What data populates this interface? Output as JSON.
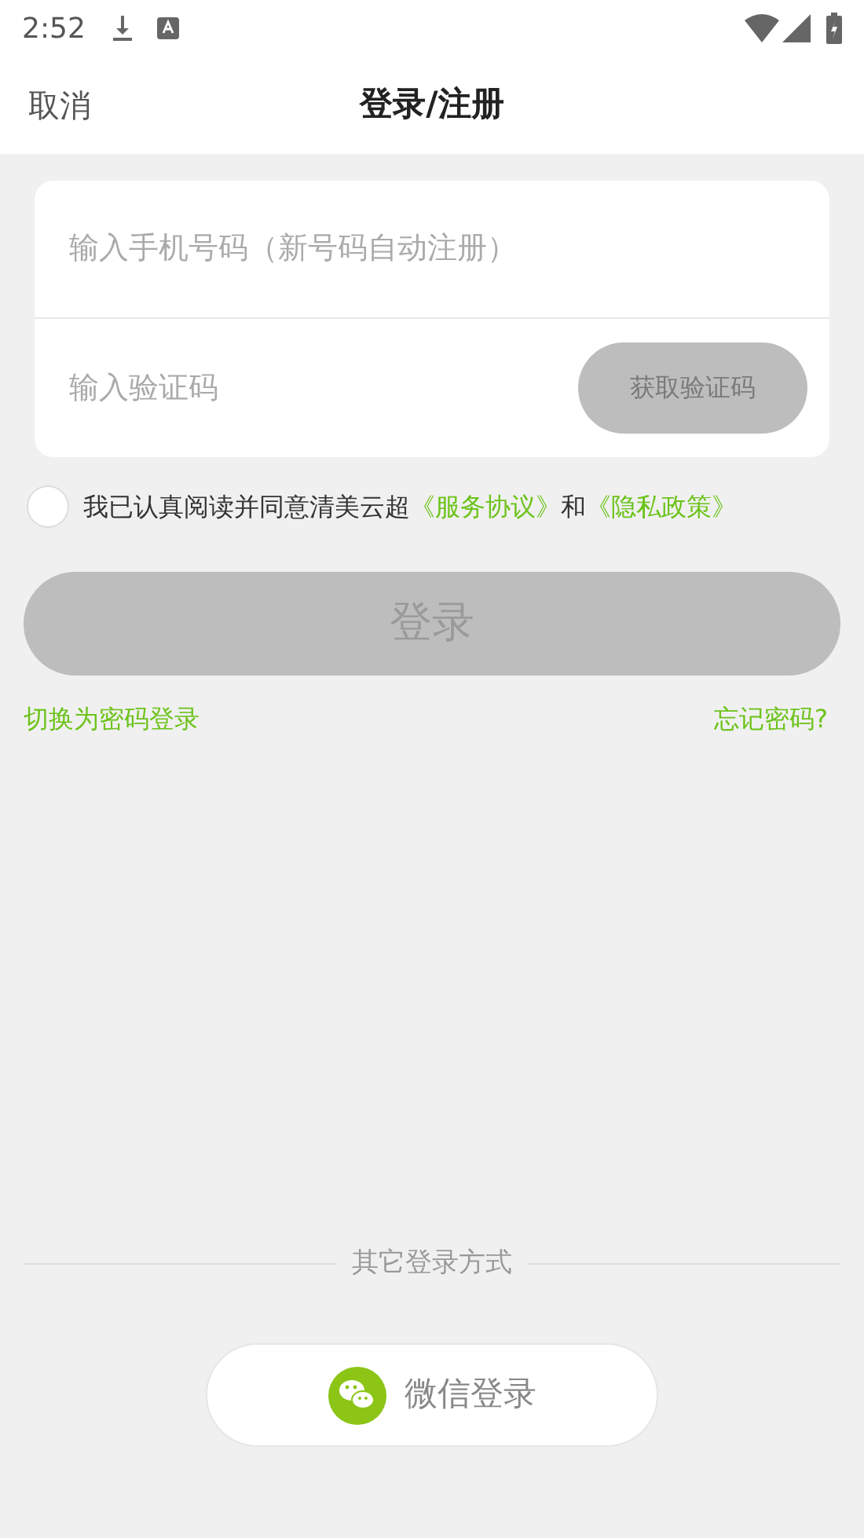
{
  "status_bar": {
    "time": "2:52"
  },
  "header": {
    "cancel": "取消",
    "title": "登录/注册"
  },
  "form": {
    "phone": {
      "placeholder": "输入手机号码（新号码自动注册）"
    },
    "code": {
      "placeholder": "输入验证码"
    },
    "get_code_button": {
      "label": "获取验证码",
      "disabled": true
    }
  },
  "agreement": {
    "checked": false,
    "parts": [
      {
        "kind": "text",
        "text": "我已认真阅读并同意清美云超"
      },
      {
        "kind": "link",
        "text": "《服务协议》"
      },
      {
        "kind": "text",
        "text": "和"
      },
      {
        "kind": "link",
        "text": "《隐私政策》"
      }
    ]
  },
  "login_button": {
    "label": "登录",
    "disabled": true
  },
  "links": {
    "switch": "切换为密码登录",
    "forgot": "忘记密码?"
  },
  "other_login": {
    "label": "其它登录方式",
    "wechat_button": "微信登录"
  }
}
